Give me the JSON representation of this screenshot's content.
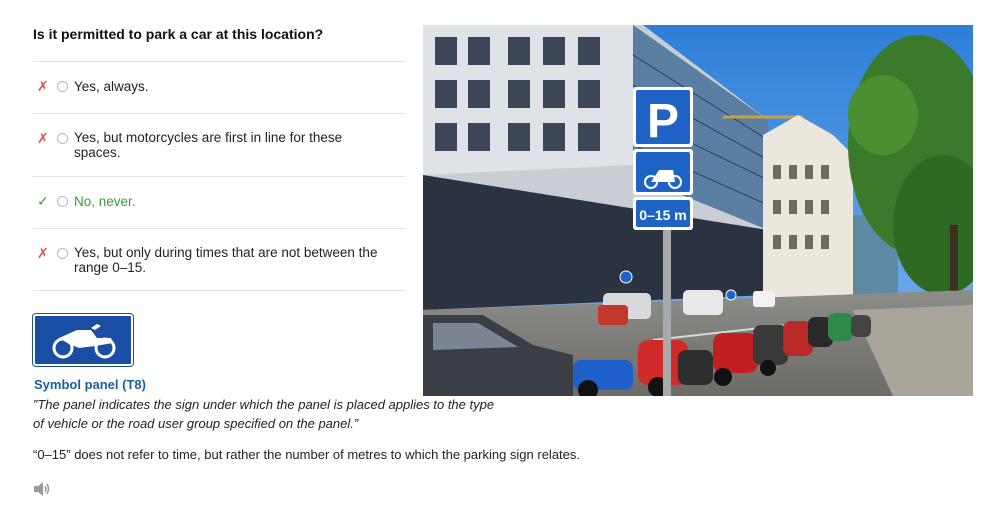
{
  "question": "Is it permitted to park a car at this location?",
  "answers": [
    {
      "mark": "✗",
      "text": "Yes, always."
    },
    {
      "mark": "✗",
      "text": "Yes, but motorcycles are first in line for these spaces."
    },
    {
      "mark": "✓",
      "text": "No, never."
    },
    {
      "mark": "✗",
      "text": "Yes, but only during times that are not between the range 0–15."
    }
  ],
  "photo": {
    "sign_p": "P",
    "sign_distance": "0–15 m"
  },
  "symbol_panel": {
    "title": "Symbol panel (T8)",
    "quote": "”The panel indicates the sign under which the panel is placed applies to the type of vehicle or the road user group specified on the panel.”"
  },
  "explanation": "“0–15” does not refer to time, but rather the number of metres to which the parking sign relates.",
  "icons": {
    "wrong": "cross-mark-icon",
    "right": "check-mark-icon",
    "audio": "speaker-icon"
  },
  "colors": {
    "wrong": "#d9534f",
    "correct": "#3a9b3a",
    "title_blue": "#1a5fa6",
    "sign_blue": "#1a4ea5"
  }
}
